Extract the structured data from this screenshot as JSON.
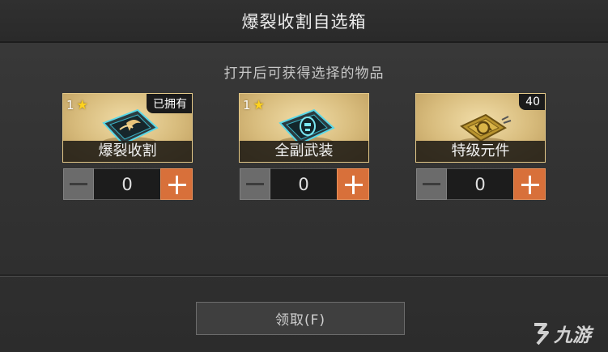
{
  "header": {
    "title": "爆裂收割自选箱"
  },
  "subtitle": "打开后可获得选择的物品",
  "items": [
    {
      "name": "爆裂收割",
      "count": "1",
      "badge": "已拥有",
      "stepper_value": "0",
      "icon": "blade-chip-icon"
    },
    {
      "name": "全副武装",
      "count": "1",
      "badge": "",
      "stepper_value": "0",
      "icon": "armor-chip-icon"
    },
    {
      "name": "特级元件",
      "count": "",
      "badge": "40",
      "stepper_value": "0",
      "icon": "gold-component-icon"
    }
  ],
  "claim_button": {
    "label": "领取(F)"
  },
  "watermark": {
    "text": "九游"
  },
  "colors": {
    "accent": "#d8703a",
    "card_border": "#e3c888",
    "star": "#ffd21e"
  }
}
